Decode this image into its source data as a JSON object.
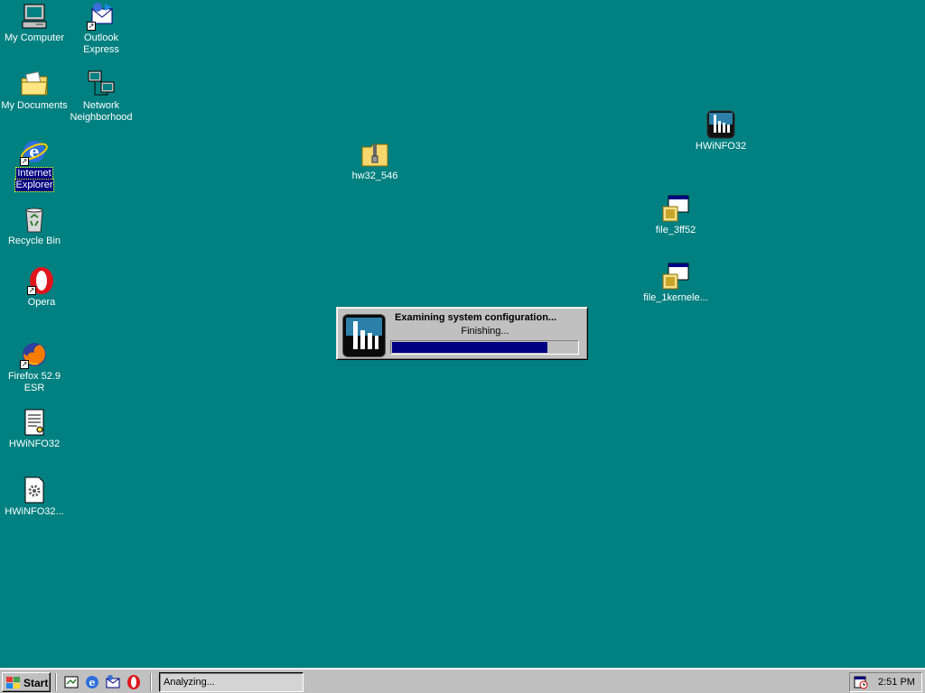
{
  "desktop": {
    "icons": [
      {
        "label_lines": [
          "My Computer"
        ],
        "icon": "computer-icon"
      },
      {
        "label_lines": [
          "Outlook",
          "Express"
        ],
        "icon": "outlook-express-icon"
      },
      {
        "label_lines": [
          "My Documents"
        ],
        "icon": "folder-documents-icon"
      },
      {
        "label_lines": [
          "Network",
          "Neighborhood"
        ],
        "icon": "network-icon"
      },
      {
        "label_lines": [
          "Internet",
          "Explorer"
        ],
        "icon": "internet-explorer-icon"
      },
      {
        "label_lines": [
          "Recycle Bin"
        ],
        "icon": "recycle-bin-icon"
      },
      {
        "label_lines": [
          "Opera"
        ],
        "icon": "opera-icon"
      },
      {
        "label_lines": [
          "Firefox 52.9",
          "ESR"
        ],
        "icon": "firefox-icon"
      },
      {
        "label_lines": [
          "HWiNFO32"
        ],
        "icon": "text-document-icon"
      },
      {
        "label_lines": [
          "HWiNFO32..."
        ],
        "icon": "settings-file-icon"
      },
      {
        "label_lines": [
          "hw32_546"
        ],
        "icon": "zip-folder-icon"
      },
      {
        "label_lines": [
          "HWiNFO32"
        ],
        "icon": "hwinfo-app-icon"
      },
      {
        "label_lines": [
          "file_3ff52"
        ],
        "icon": "installer-icon"
      },
      {
        "label_lines": [
          "file_1kernele..."
        ],
        "icon": "installer-icon"
      }
    ]
  },
  "dialog": {
    "title": "Examining system configuration...",
    "status": "Finishing...",
    "progress": 0.84
  },
  "taskbar": {
    "start_label": "Start",
    "active_task": "Analyzing...",
    "clock": "2:51 PM",
    "quick_launch": [
      "show-desktop-icon",
      "internet-explorer-icon",
      "outlook-express-icon",
      "opera-icon"
    ]
  },
  "colors": {
    "desktop": "#008080",
    "progress": "#000080",
    "chrome": "#c0c0c0"
  }
}
